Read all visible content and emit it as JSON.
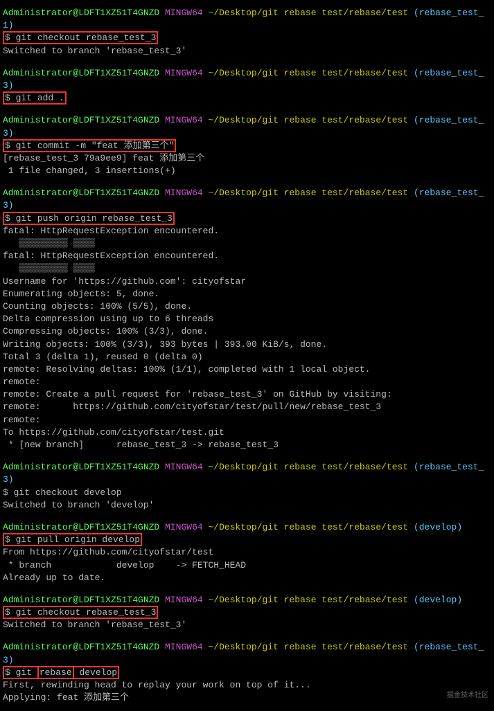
{
  "prompt": {
    "user": "Administrator",
    "host": "LDFT1XZ51T4GNZD",
    "shell": "MINGW64",
    "path": "~/Desktop/git rebase test/rebase/test"
  },
  "blocks": [
    {
      "branch": "rebase_test_1",
      "cmd": "git checkout rebase_test_3",
      "highlight_cmd": true,
      "highlight_prompt": true,
      "output": [
        "Switched to branch 'rebase_test_3'"
      ]
    },
    {
      "branch": "rebase_test_3",
      "cmd": "git add .",
      "highlight_cmd": true,
      "highlight_prompt": true,
      "output": []
    },
    {
      "branch": "rebase_test_3",
      "cmd": "git commit -m \"feat 添加第三个\"",
      "highlight_cmd": true,
      "highlight_prompt": true,
      "output": [
        "[rebase_test_3 79a9ee9] feat 添加第三个",
        " 1 file changed, 3 insertions(+)"
      ]
    },
    {
      "branch": "rebase_test_3",
      "cmd": "git push origin rebase_test_3",
      "highlight_cmd": true,
      "highlight_prompt": true,
      "output": [
        "fatal: HttpRequestException encountered.",
        "   ▒▒▒▒▒▒▒▒▒ ▒▒▒▒",
        "fatal: HttpRequestException encountered.",
        "   ▒▒▒▒▒▒▒▒▒ ▒▒▒▒",
        "Username for 'https://github.com': cityofstar",
        "Enumerating objects: 5, done.",
        "Counting objects: 100% (5/5), done.",
        "Delta compression using up to 6 threads",
        "Compressing objects: 100% (3/3), done.",
        "Writing objects: 100% (3/3), 393 bytes | 393.00 KiB/s, done.",
        "Total 3 (delta 1), reused 0 (delta 0)",
        "remote: Resolving deltas: 100% (1/1), completed with 1 local object.",
        "remote:",
        "remote: Create a pull request for 'rebase_test_3' on GitHub by visiting:",
        "remote:      https://github.com/cityofstar/test/pull/new/rebase_test_3",
        "remote:",
        "To https://github.com/cityofstar/test.git",
        " * [new branch]      rebase_test_3 -> rebase_test_3"
      ]
    },
    {
      "branch": "rebase_test_3",
      "cmd": "git checkout develop",
      "highlight_cmd": false,
      "highlight_prompt": false,
      "output": [
        "Switched to branch 'develop'"
      ]
    },
    {
      "branch": "develop",
      "cmd": "git pull origin develop",
      "highlight_cmd": true,
      "highlight_prompt": true,
      "output": [
        "From https://github.com/cityofstar/test",
        " * branch            develop    -> FETCH_HEAD",
        "Already up to date."
      ]
    },
    {
      "branch": "develop",
      "cmd": "git checkout rebase_test_3",
      "highlight_cmd": true,
      "highlight_prompt": true,
      "output": [
        "Switched to branch 'rebase_test_3'"
      ]
    }
  ],
  "last_block": {
    "branch": "rebase_test_3",
    "cmd_pre": "git ",
    "cmd_hw": "rebase",
    "cmd_post": " develop",
    "output": [
      "First, rewinding head to replay your work on top of it...",
      "Applying: feat 添加第三个"
    ]
  },
  "watermark": "掘金技术社区"
}
